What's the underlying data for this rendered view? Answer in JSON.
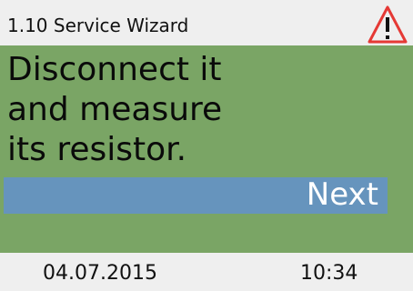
{
  "header": {
    "title": "1.10 Service Wizard",
    "warning_icon": "warning-triangle-icon",
    "warning_color": "#e53935"
  },
  "main": {
    "message": "Disconnect it\nand measure\nits resistor.",
    "next_label": "Next",
    "background_color": "#7aa565",
    "button_color": "#6694bd"
  },
  "footer": {
    "date": "04.07.2015",
    "time": "10:34"
  }
}
